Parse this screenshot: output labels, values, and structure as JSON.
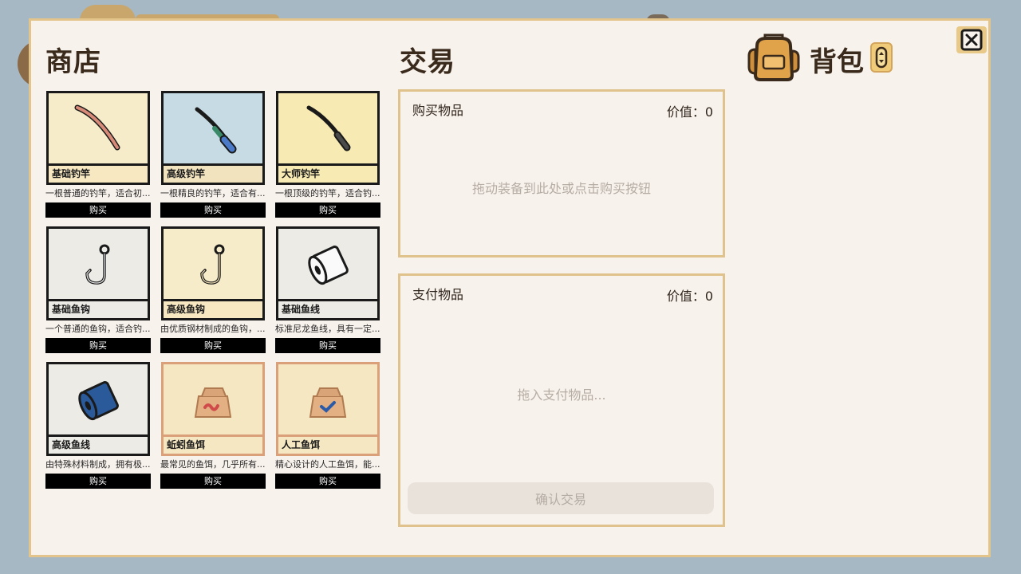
{
  "shop": {
    "title": "商店",
    "items": [
      {
        "name": "基础钓竿",
        "desc": "一根普通的钓竿，适合初...",
        "buy_label": "购买",
        "icon": "basic-rod-icon"
      },
      {
        "name": "高级钓竿",
        "desc": "一根精良的钓竿，适合有...",
        "buy_label": "购买",
        "icon": "advanced-rod-icon"
      },
      {
        "name": "大师钓竿",
        "desc": "一根顶级的钓竿，适合钓...",
        "buy_label": "购买",
        "icon": "master-rod-icon"
      },
      {
        "name": "基础鱼钩",
        "desc": "一个普通的鱼钩，适合钓...",
        "buy_label": "购买",
        "icon": "basic-hook-icon"
      },
      {
        "name": "高级鱼钩",
        "desc": "由优质钢材制成的鱼钩，...",
        "buy_label": "购买",
        "icon": "advanced-hook-icon"
      },
      {
        "name": "基础鱼线",
        "desc": "标准尼龙鱼线，具有一定...",
        "buy_label": "购买",
        "icon": "basic-line-icon"
      },
      {
        "name": "高级鱼线",
        "desc": "由特殊材料制成，拥有极...",
        "buy_label": "购买",
        "icon": "advanced-line-icon"
      },
      {
        "name": "蚯蚓鱼饵",
        "desc": "最常见的鱼饵，几乎所有...",
        "buy_label": "购买",
        "icon": "worm-bait-icon"
      },
      {
        "name": "人工鱼饵",
        "desc": "精心设计的人工鱼饵，能...",
        "buy_label": "购买",
        "icon": "artificial-bait-icon"
      }
    ]
  },
  "trade": {
    "title": "交易",
    "buy_box": {
      "title": "购买物品",
      "value_label": "价值：0",
      "hint": "拖动装备到此处或点击购买按钮"
    },
    "pay_box": {
      "title": "支付物品",
      "value_label": "价值：0",
      "hint": "拖入支付物品..."
    },
    "confirm_label": "确认交易"
  },
  "backpack": {
    "title": "背包",
    "icon": "backpack-icon",
    "sort_icon": "sort-toggle-icon"
  },
  "close_icon": "close-icon",
  "colors": {
    "panel_bg": "#f8f2ec",
    "panel_border": "#e3c48a",
    "buy_button": "#000000",
    "confirm_disabled": "#e8e2db",
    "page_bg": "#a6b8c4"
  }
}
